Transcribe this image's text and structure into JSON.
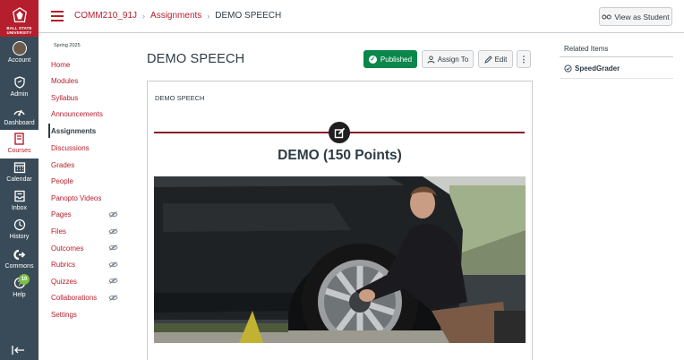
{
  "global_nav": {
    "logo_text": "BALL STATE\nUNIVERSITY",
    "items": [
      {
        "label": "Account",
        "icon": "avatar"
      },
      {
        "label": "Admin",
        "icon": "shield-icon"
      },
      {
        "label": "Dashboard",
        "icon": "dashboard-icon"
      },
      {
        "label": "Courses",
        "icon": "book-icon"
      },
      {
        "label": "Calendar",
        "icon": "calendar-icon"
      },
      {
        "label": "Inbox",
        "icon": "inbox-icon"
      },
      {
        "label": "History",
        "icon": "clock-icon"
      },
      {
        "label": "Commons",
        "icon": "commons-icon"
      },
      {
        "label": "Help",
        "icon": "help-icon",
        "badge": "10"
      }
    ]
  },
  "header": {
    "breadcrumbs": [
      "COMM210_91J",
      "Assignments",
      "DEMO SPEECH"
    ],
    "view_as_student": "View as Student"
  },
  "course_nav": {
    "term": "Spring 2025",
    "items": [
      {
        "label": "Home"
      },
      {
        "label": "Modules"
      },
      {
        "label": "Syllabus"
      },
      {
        "label": "Announcements"
      },
      {
        "label": "Assignments"
      },
      {
        "label": "Discussions"
      },
      {
        "label": "Grades"
      },
      {
        "label": "People"
      },
      {
        "label": "Panopto Videos"
      },
      {
        "label": "Pages"
      },
      {
        "label": "Files"
      },
      {
        "label": "Outcomes"
      },
      {
        "label": "Rubrics"
      },
      {
        "label": "Quizzes"
      },
      {
        "label": "Collaborations"
      },
      {
        "label": "Settings"
      }
    ]
  },
  "main": {
    "title": "DEMO SPEECH",
    "published_label": "Published",
    "assign_to_label": "Assign To",
    "edit_label": "Edit",
    "more_label": "⋮",
    "content_small_title": "DEMO SPEECH",
    "content_heading": "DEMO (150 Points)"
  },
  "sidebar": {
    "related_items_title": "Related Items",
    "speedgrader_label": "SpeedGrader"
  },
  "colors": {
    "brand": "#b51e2c",
    "nav_bg": "#394b58",
    "published": "#0b874b",
    "divider": "#8a1c2b"
  }
}
